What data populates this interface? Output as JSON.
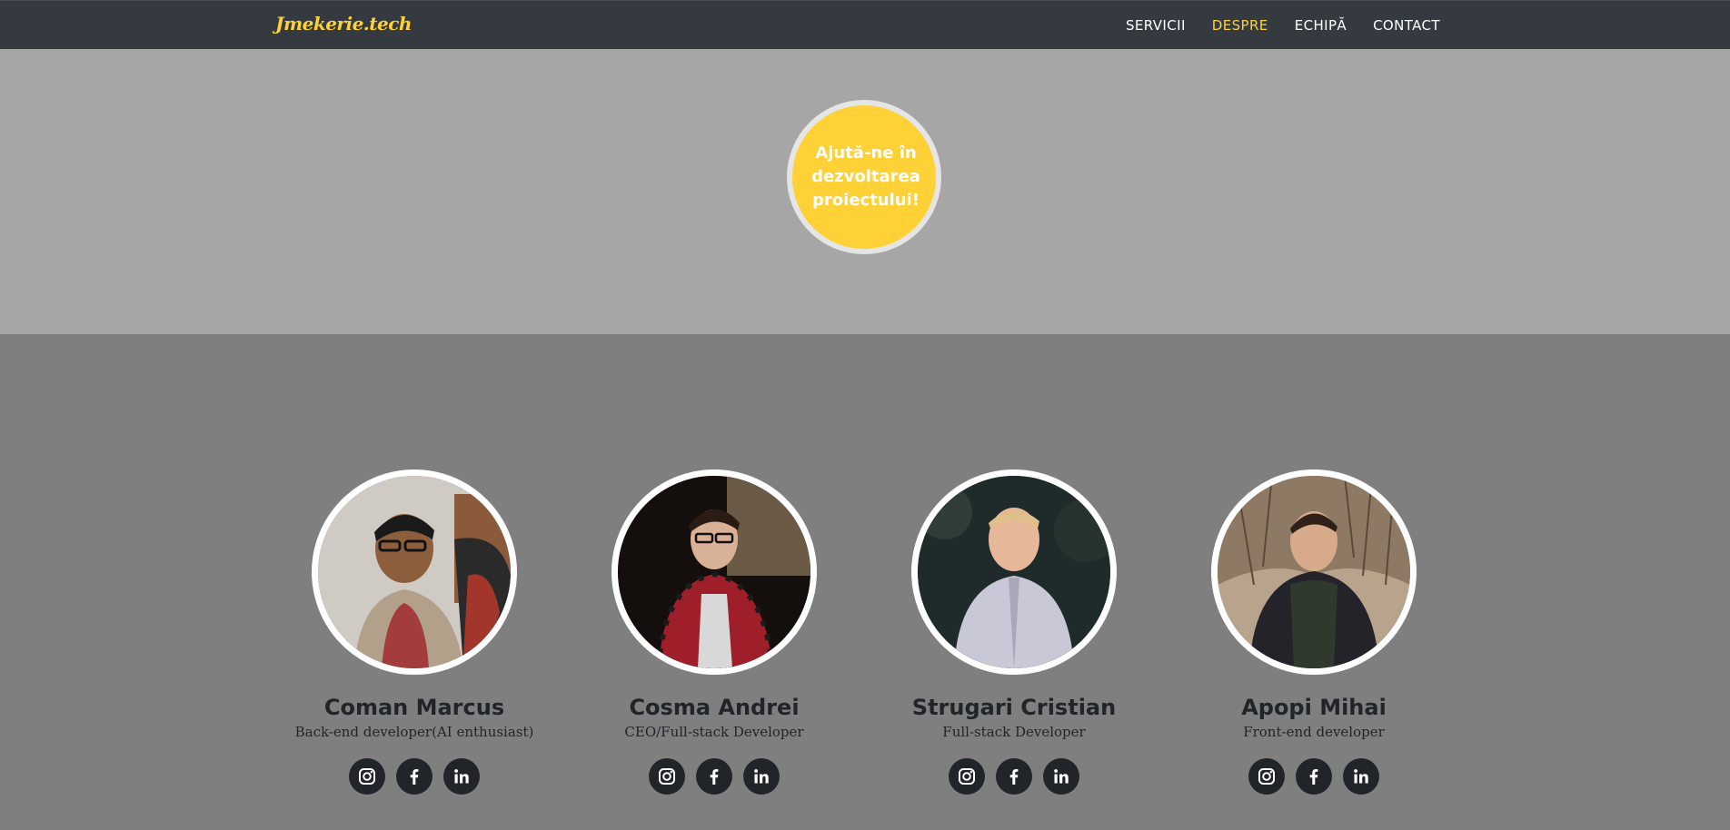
{
  "navbar": {
    "brand": "Jmekerie.tech",
    "links": [
      {
        "label": "SERVICII",
        "active": false
      },
      {
        "label": "DESPRE",
        "active": true
      },
      {
        "label": "ECHIPĂ",
        "active": false
      },
      {
        "label": "CONTACT",
        "active": false
      }
    ]
  },
  "hero": {
    "cta_text": "Ajută-ne în dezvoltarea proiectului!"
  },
  "team": {
    "members": [
      {
        "name": "Coman Marcus",
        "role": "Back-end developer(AI enthusiast)"
      },
      {
        "name": "Cosma Andrei",
        "role": "CEO/Full-stack Developer"
      },
      {
        "name": "Strugari Cristian",
        "role": "Full-stack Developer"
      },
      {
        "name": "Apopi Mihai",
        "role": "Front-end developer"
      }
    ],
    "social_icons": [
      "instagram-icon",
      "facebook-icon",
      "linkedin-icon"
    ]
  },
  "colors": {
    "navbar_bg": "#343a40",
    "accent": "#fed136",
    "hero_bg": "#a6a6a6",
    "team_bg": "#7f7f7f",
    "text_dark": "#212529"
  }
}
